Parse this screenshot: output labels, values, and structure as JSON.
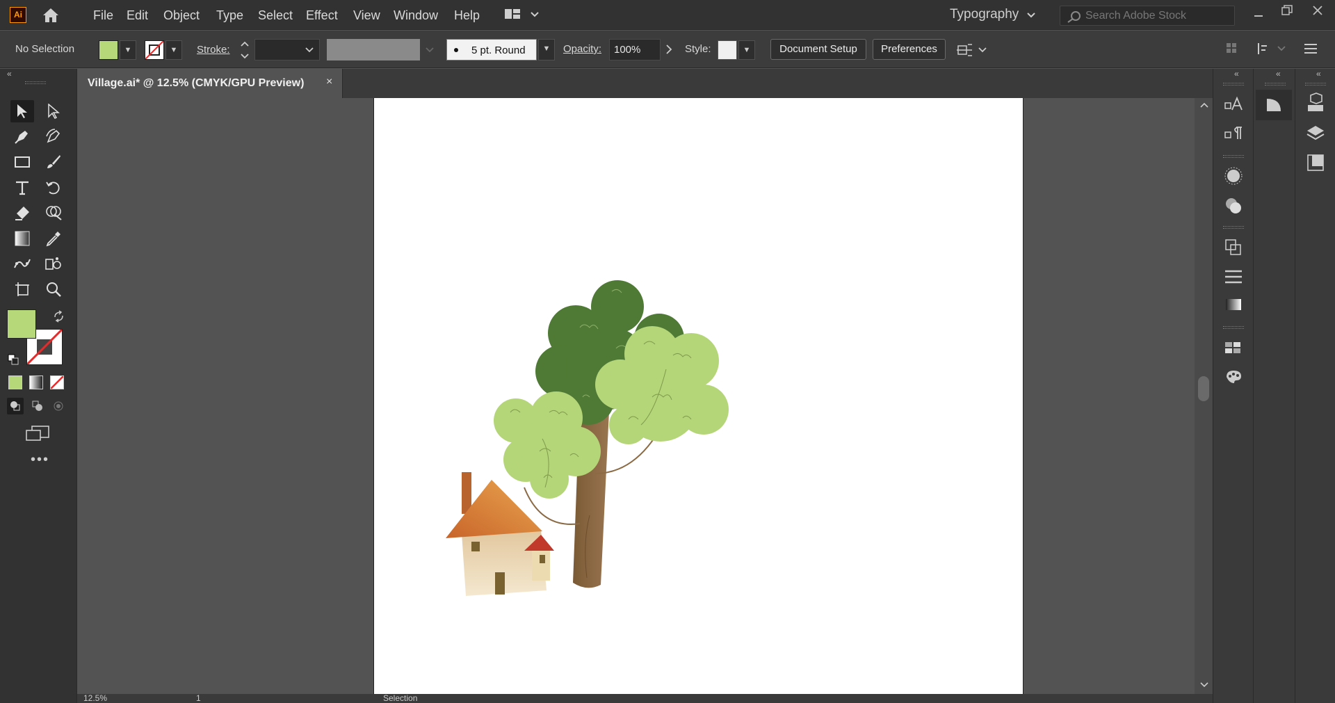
{
  "app": {
    "logo_text": "Ai"
  },
  "menu": [
    "File",
    "Edit",
    "Object",
    "Type",
    "Select",
    "Effect",
    "View",
    "Window",
    "Help"
  ],
  "workspace": {
    "label": "Typography"
  },
  "search": {
    "placeholder": "Search Adobe Stock"
  },
  "control": {
    "selection_label": "No Selection",
    "fill_color": "#b7d878",
    "stroke_label": "Stroke:",
    "brush_label": "5 pt. Round",
    "opacity_label": "Opacity:",
    "opacity_value": "100%",
    "style_label": "Style:",
    "document_setup": "Document Setup",
    "preferences": "Preferences"
  },
  "document": {
    "tab_title": "Village.ai* @ 12.5% (CMYK/GPU Preview)",
    "close": "×"
  },
  "status": {
    "zoom": "12.5%",
    "artboard_number": "1",
    "tool_name": "Selection"
  },
  "colors": {
    "tree_dark": "#4f7a35",
    "tree_light": "#b5d579",
    "trunk": "#8b6a44",
    "roof": "#d9823a",
    "small_roof": "#c0392b",
    "wall": "#e8d6b0",
    "door": "#7a6230"
  }
}
